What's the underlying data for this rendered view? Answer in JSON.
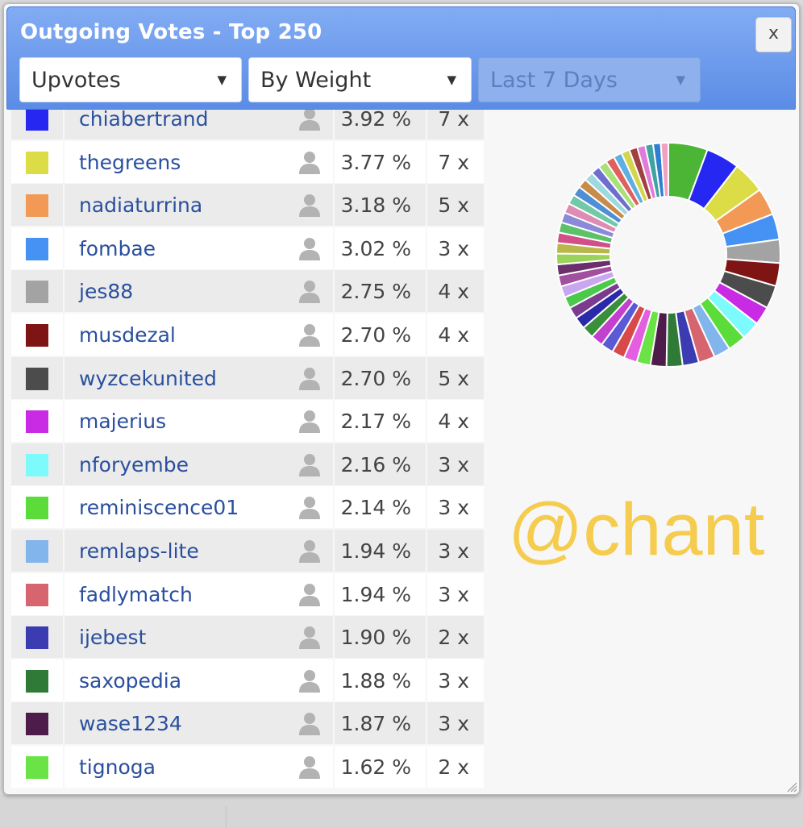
{
  "dialog": {
    "title": "Outgoing Votes - Top 250",
    "close_label": "x",
    "filters": [
      {
        "value": "Upvotes",
        "enabled": true
      },
      {
        "value": "By Weight",
        "enabled": true
      },
      {
        "value": "Last 7 Days",
        "enabled": false
      }
    ]
  },
  "table": {
    "rows": [
      {
        "color": "#2727f2",
        "name": "chiabertrand",
        "percent": "3.92 %",
        "count": "7 x"
      },
      {
        "color": "#dcdc47",
        "name": "thegreens",
        "percent": "3.77 %",
        "count": "7 x"
      },
      {
        "color": "#f29a55",
        "name": "nadiaturrina",
        "percent": "3.18 %",
        "count": "5 x"
      },
      {
        "color": "#4592f4",
        "name": "fombae",
        "percent": "3.02 %",
        "count": "3 x"
      },
      {
        "color": "#a3a3a3",
        "name": "jes88",
        "percent": "2.75 %",
        "count": "4 x"
      },
      {
        "color": "#7f1414",
        "name": "musdezal",
        "percent": "2.70 %",
        "count": "4 x"
      },
      {
        "color": "#4c4c4c",
        "name": "wyzcekunited",
        "percent": "2.70 %",
        "count": "5 x"
      },
      {
        "color": "#c92ae3",
        "name": "majerius",
        "percent": "2.17 %",
        "count": "4 x"
      },
      {
        "color": "#7dfbfc",
        "name": "nforyembe",
        "percent": "2.16 %",
        "count": "3 x"
      },
      {
        "color": "#5bdc3b",
        "name": "reminiscence01",
        "percent": "2.14 %",
        "count": "3 x"
      },
      {
        "color": "#82b5ec",
        "name": "remlaps-lite",
        "percent": "1.94 %",
        "count": "3 x"
      },
      {
        "color": "#d76570",
        "name": "fadlymatch",
        "percent": "1.94 %",
        "count": "3 x"
      },
      {
        "color": "#3b3cb2",
        "name": "ijebest",
        "percent": "1.90 %",
        "count": "2 x"
      },
      {
        "color": "#2f7a37",
        "name": "saxopedia",
        "percent": "1.88 %",
        "count": "3 x"
      },
      {
        "color": "#4e1c4a",
        "name": "wase1234",
        "percent": "1.87 %",
        "count": "3 x"
      },
      {
        "color": "#6ae347",
        "name": "tignoga",
        "percent": "1.62 %",
        "count": "2 x"
      }
    ]
  },
  "donut": {
    "first_color": "#4cb535",
    "slices": [
      {
        "color": "#4cb535",
        "value": 4.6
      },
      {
        "color": "#2727f2",
        "value": 3.92
      },
      {
        "color": "#dcdc47",
        "value": 3.77
      },
      {
        "color": "#f29a55",
        "value": 3.18
      },
      {
        "color": "#4592f4",
        "value": 3.02
      },
      {
        "color": "#a3a3a3",
        "value": 2.75
      },
      {
        "color": "#7f1414",
        "value": 2.7
      },
      {
        "color": "#4c4c4c",
        "value": 2.7
      },
      {
        "color": "#c92ae3",
        "value": 2.17
      },
      {
        "color": "#7dfbfc",
        "value": 2.16
      },
      {
        "color": "#5bdc3b",
        "value": 2.14
      },
      {
        "color": "#82b5ec",
        "value": 1.94
      },
      {
        "color": "#d76570",
        "value": 1.94
      },
      {
        "color": "#3b3cb2",
        "value": 1.9
      },
      {
        "color": "#2f7a37",
        "value": 1.88
      },
      {
        "color": "#4e1c4a",
        "value": 1.87
      },
      {
        "color": "#6ae347",
        "value": 1.62
      },
      {
        "color": "#e35fe0",
        "value": 1.55
      },
      {
        "color": "#d84a4a",
        "value": 1.5
      },
      {
        "color": "#5a5ad6",
        "value": 1.48
      },
      {
        "color": "#c23fcf",
        "value": 1.45
      },
      {
        "color": "#3a8f3a",
        "value": 1.42
      },
      {
        "color": "#2a2aa8",
        "value": 1.4
      },
      {
        "color": "#7b3c8f",
        "value": 1.38
      },
      {
        "color": "#4bc94b",
        "value": 1.35
      },
      {
        "color": "#c9a6f0",
        "value": 1.33
      },
      {
        "color": "#a14f9e",
        "value": 1.3
      },
      {
        "color": "#6b2f6b",
        "value": 1.28
      },
      {
        "color": "#9bd35a",
        "value": 1.26
      },
      {
        "color": "#b8b84a",
        "value": 1.24
      },
      {
        "color": "#d24f88",
        "value": 1.22
      },
      {
        "color": "#5cc26a",
        "value": 1.2
      },
      {
        "color": "#8a8ad8",
        "value": 1.18
      },
      {
        "color": "#e08bb4",
        "value": 1.16
      },
      {
        "color": "#72c9a8",
        "value": 1.14
      },
      {
        "color": "#4f8fd6",
        "value": 1.12
      },
      {
        "color": "#c78b4a",
        "value": 1.1
      },
      {
        "color": "#9dd9e0",
        "value": 1.08
      },
      {
        "color": "#6e6ed0",
        "value": 1.06
      },
      {
        "color": "#a8e07a",
        "value": 1.04
      },
      {
        "color": "#e06060",
        "value": 1.02
      },
      {
        "color": "#5fb0e0",
        "value": 1.0
      },
      {
        "color": "#d4d44f",
        "value": 0.98
      },
      {
        "color": "#a04040",
        "value": 0.96
      },
      {
        "color": "#e27ad9",
        "value": 0.94
      },
      {
        "color": "#3fa3a3",
        "value": 0.92
      },
      {
        "color": "#2f7fd0",
        "value": 0.9
      },
      {
        "color": "#f0a0c0",
        "value": 0.88
      }
    ]
  },
  "watermark": "@chant"
}
